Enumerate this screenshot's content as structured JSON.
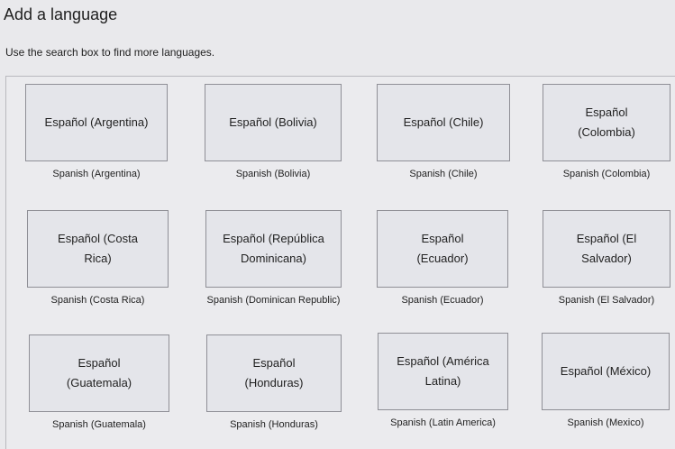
{
  "window": {
    "title": "Add a language",
    "hint": "Use the search box to find more languages."
  },
  "languages": [
    {
      "native": "Español (Argentina)",
      "english": "Spanish (Argentina)"
    },
    {
      "native": "Español (Bolivia)",
      "english": "Spanish (Bolivia)"
    },
    {
      "native": "Español (Chile)",
      "english": "Spanish (Chile)"
    },
    {
      "native": "Español (Colombia)",
      "english": "Spanish (Colombia)"
    },
    {
      "native": "Español (Costa Rica)",
      "english": "Spanish (Costa Rica)"
    },
    {
      "native": "Español (República Dominicana)",
      "english": "Spanish (Dominican Republic)"
    },
    {
      "native": "Español (Ecuador)",
      "english": "Spanish (Ecuador)"
    },
    {
      "native": "Español (El Salvador)",
      "english": "Spanish (El Salvador)"
    },
    {
      "native": "Español (Guatemala)",
      "english": "Spanish (Guatemala)"
    },
    {
      "native": "Español (Honduras)",
      "english": "Spanish (Honduras)"
    },
    {
      "native": "Español (América Latina)",
      "english": "Spanish (Latin America)"
    },
    {
      "native": "Español (México)",
      "english": "Spanish (Mexico)"
    }
  ]
}
